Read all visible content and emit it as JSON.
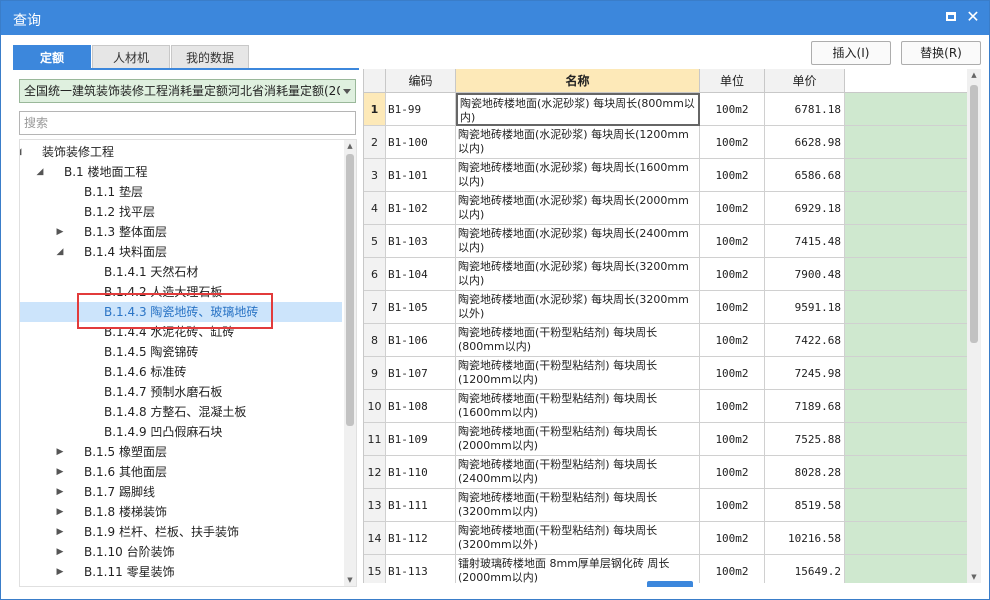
{
  "window": {
    "title": "查询"
  },
  "tabs": [
    {
      "label": "定额",
      "active": true
    },
    {
      "label": "人材机",
      "active": false
    },
    {
      "label": "我的数据",
      "active": false
    }
  ],
  "toolbar": {
    "insert_label": "插入(I)",
    "replace_label": "替换(R)"
  },
  "library": {
    "selected": "全国统一建筑装饰装修工程消耗量定额河北省消耗量定额(20"
  },
  "search": {
    "placeholder": "搜索"
  },
  "tree": [
    {
      "label": "装饰装修工程",
      "level": 0,
      "toggle": "◢"
    },
    {
      "label": "B.1 楼地面工程",
      "level": 1,
      "toggle": "◢"
    },
    {
      "label": "B.1.1 垫层",
      "level": 2,
      "toggle": ""
    },
    {
      "label": "B.1.2 找平层",
      "level": 2,
      "toggle": ""
    },
    {
      "label": "B.1.3 整体面层",
      "level": 2,
      "toggle": "▶"
    },
    {
      "label": "B.1.4 块料面层",
      "level": 2,
      "toggle": "◢"
    },
    {
      "label": "B.1.4.1 天然石材",
      "level": 3,
      "toggle": ""
    },
    {
      "label": "B.1.4.2 人造大理石板",
      "level": 3,
      "toggle": ""
    },
    {
      "label": "B.1.4.3 陶瓷地砖、玻璃地砖",
      "level": 3,
      "toggle": "",
      "selected": true
    },
    {
      "label": "B.1.4.4 水泥花砖、缸砖",
      "level": 3,
      "toggle": ""
    },
    {
      "label": "B.1.4.5 陶瓷锦砖",
      "level": 3,
      "toggle": ""
    },
    {
      "label": "B.1.4.6 标准砖",
      "level": 3,
      "toggle": ""
    },
    {
      "label": "B.1.4.7 预制水磨石板",
      "level": 3,
      "toggle": ""
    },
    {
      "label": "B.1.4.8 方整石、混凝土板",
      "level": 3,
      "toggle": ""
    },
    {
      "label": "B.1.4.9 凹凸假麻石块",
      "level": 3,
      "toggle": ""
    },
    {
      "label": "B.1.5 橡塑面层",
      "level": 2,
      "toggle": "▶"
    },
    {
      "label": "B.1.6 其他面层",
      "level": 2,
      "toggle": "▶"
    },
    {
      "label": "B.1.7 踢脚线",
      "level": 2,
      "toggle": "▶"
    },
    {
      "label": "B.1.8 楼梯装饰",
      "level": 2,
      "toggle": "▶"
    },
    {
      "label": "B.1.9 栏杆、栏板、扶手装饰",
      "level": 2,
      "toggle": "▶"
    },
    {
      "label": "B.1.10 台阶装饰",
      "level": 2,
      "toggle": "▶"
    },
    {
      "label": "B.1.11 零星装饰",
      "level": 2,
      "toggle": "▶"
    }
  ],
  "table": {
    "columns": [
      "编码",
      "名称",
      "单位",
      "单价"
    ],
    "rows": [
      {
        "idx": "1",
        "code": "B1-99",
        "name": "陶瓷地砖楼地面(水泥砂浆) 每块周长(800mm以内)",
        "unit": "100m2",
        "price": "6781.18"
      },
      {
        "idx": "2",
        "code": "B1-100",
        "name": "陶瓷地砖楼地面(水泥砂浆) 每块周长(1200mm以内)",
        "unit": "100m2",
        "price": "6628.98"
      },
      {
        "idx": "3",
        "code": "B1-101",
        "name": "陶瓷地砖楼地面(水泥砂浆) 每块周长(1600mm以内)",
        "unit": "100m2",
        "price": "6586.68"
      },
      {
        "idx": "4",
        "code": "B1-102",
        "name": "陶瓷地砖楼地面(水泥砂浆) 每块周长(2000mm以内)",
        "unit": "100m2",
        "price": "6929.18"
      },
      {
        "idx": "5",
        "code": "B1-103",
        "name": "陶瓷地砖楼地面(水泥砂浆) 每块周长(2400mm以内)",
        "unit": "100m2",
        "price": "7415.48"
      },
      {
        "idx": "6",
        "code": "B1-104",
        "name": "陶瓷地砖楼地面(水泥砂浆) 每块周长(3200mm以内)",
        "unit": "100m2",
        "price": "7900.48"
      },
      {
        "idx": "7",
        "code": "B1-105",
        "name": "陶瓷地砖楼地面(水泥砂浆) 每块周长(3200mm以外)",
        "unit": "100m2",
        "price": "9591.18"
      },
      {
        "idx": "8",
        "code": "B1-106",
        "name": "陶瓷地砖楼地面(干粉型粘结剂) 每块周长(800mm以内)",
        "unit": "100m2",
        "price": "7422.68"
      },
      {
        "idx": "9",
        "code": "B1-107",
        "name": "陶瓷地砖楼地面(干粉型粘结剂) 每块周长(1200mm以内)",
        "unit": "100m2",
        "price": "7245.98"
      },
      {
        "idx": "10",
        "code": "B1-108",
        "name": "陶瓷地砖楼地面(干粉型粘结剂) 每块周长(1600mm以内)",
        "unit": "100m2",
        "price": "7189.68"
      },
      {
        "idx": "11",
        "code": "B1-109",
        "name": "陶瓷地砖楼地面(干粉型粘结剂) 每块周长(2000mm以内)",
        "unit": "100m2",
        "price": "7525.88"
      },
      {
        "idx": "12",
        "code": "B1-110",
        "name": "陶瓷地砖楼地面(干粉型粘结剂) 每块周长(2400mm以内)",
        "unit": "100m2",
        "price": "8028.28"
      },
      {
        "idx": "13",
        "code": "B1-111",
        "name": "陶瓷地砖楼地面(干粉型粘结剂) 每块周长(3200mm以内)",
        "unit": "100m2",
        "price": "8519.58"
      },
      {
        "idx": "14",
        "code": "B1-112",
        "name": "陶瓷地砖楼地面(干粉型粘结剂) 每块周长(3200mm以外)",
        "unit": "100m2",
        "price": "10216.58"
      },
      {
        "idx": "15",
        "code": "B1-113",
        "name": "镭射玻璃砖楼地面 8mm厚单层钢化砖 周长(2000mm以内)",
        "unit": "100m2",
        "price": "15649.2"
      }
    ]
  },
  "colors": {
    "accent": "#3c87dc",
    "header_highlight": "#fde9b8",
    "extra_col": "#cfe8cf",
    "selection_box": "#e23b3b"
  }
}
